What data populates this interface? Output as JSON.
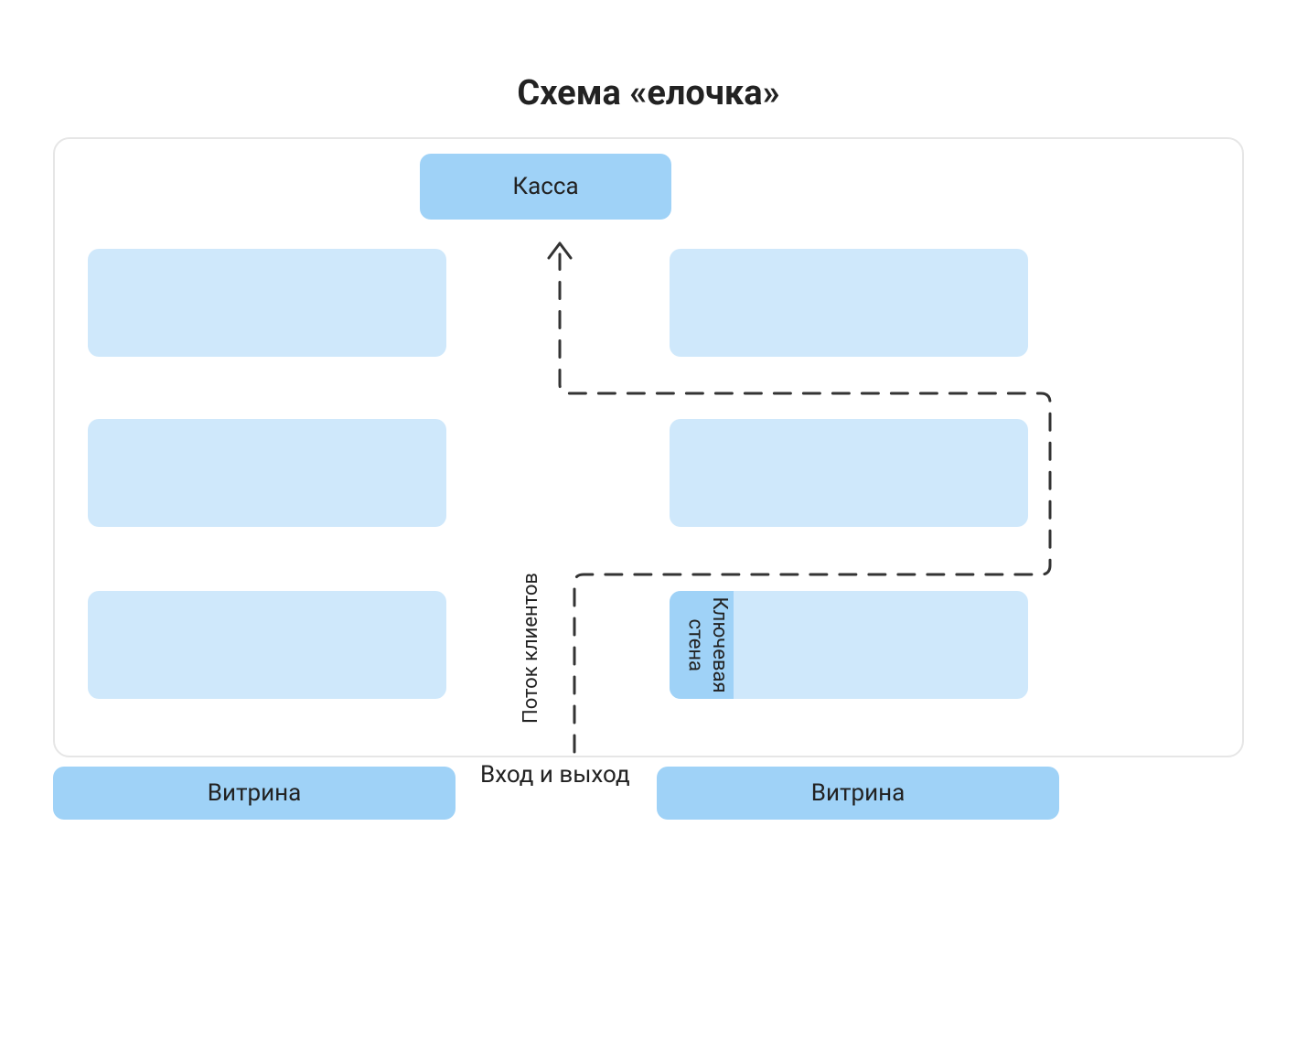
{
  "title": "Схема «елочка»",
  "register": {
    "label": "Касса"
  },
  "flow_label": "Поток клиентов",
  "entrance_label": "Вход и выход",
  "keywall": {
    "label": "Ключевая стена"
  },
  "vitrine_left": "Витрина",
  "vitrine_right": "Витрина",
  "colors": {
    "light_blue": "#cfe8fb",
    "dark_blue": "#9fd2f7",
    "outline": "#e6e6e6",
    "text": "#222222",
    "path": "#333333"
  }
}
